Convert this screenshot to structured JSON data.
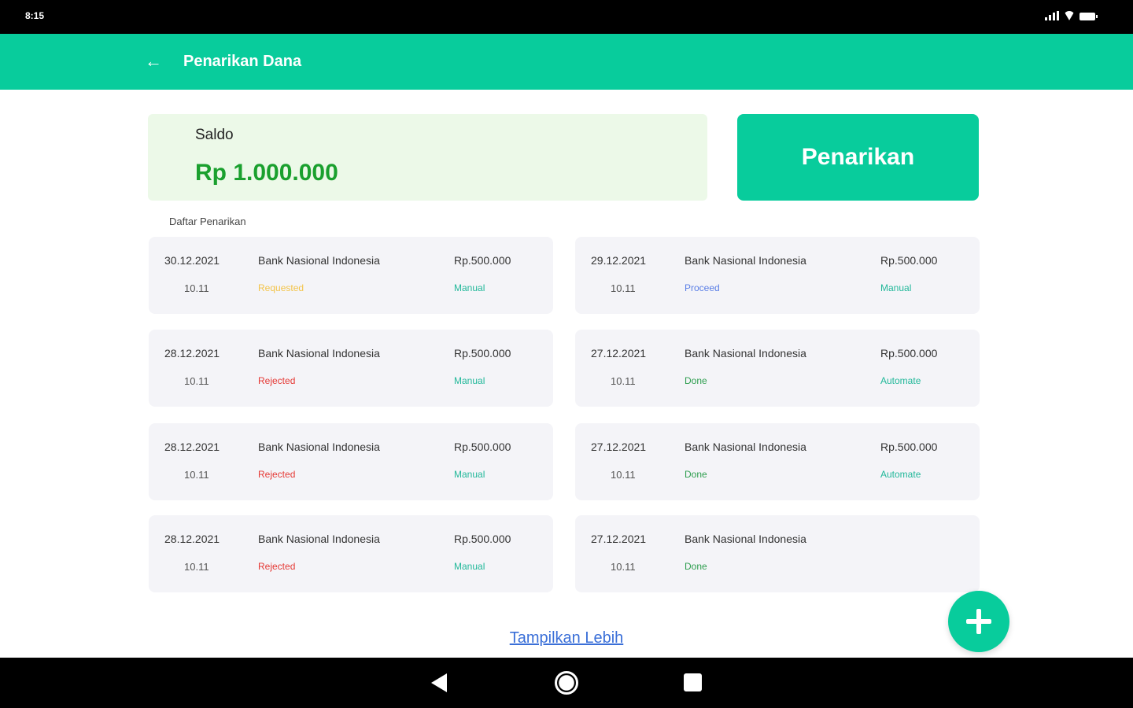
{
  "status_bar": {
    "time": "8:15"
  },
  "app_bar": {
    "back_icon": "←",
    "title": "Penarikan Dana"
  },
  "saldo": {
    "label": "Saldo",
    "value": "Rp 1.000.000"
  },
  "withdraw_button": {
    "label": "Penarikan"
  },
  "list_title": "Daftar Penarikan",
  "transactions": [
    {
      "date": "30.12.2021",
      "time": "10.11",
      "bank": "Bank Nasional Indonesia",
      "status": "Requested",
      "amount": "Rp.500.000",
      "type": "Manual"
    },
    {
      "date": "29.12.2021",
      "time": "10.11",
      "bank": "Bank Nasional Indonesia",
      "status": "Proceed",
      "amount": "Rp.500.000",
      "type": "Manual"
    },
    {
      "date": "28.12.2021",
      "time": "10.11",
      "bank": "Bank Nasional Indonesia",
      "status": "Rejected",
      "amount": "Rp.500.000",
      "type": "Manual"
    },
    {
      "date": "27.12.2021",
      "time": "10.11",
      "bank": "Bank Nasional Indonesia",
      "status": "Done",
      "amount": "Rp.500.000",
      "type": "Automate"
    },
    {
      "date": "28.12.2021",
      "time": "10.11",
      "bank": "Bank Nasional Indonesia",
      "status": "Rejected",
      "amount": "Rp.500.000",
      "type": "Manual"
    },
    {
      "date": "27.12.2021",
      "time": "10.11",
      "bank": "Bank Nasional Indonesia",
      "status": "Done",
      "amount": "Rp.500.000",
      "type": "Automate"
    },
    {
      "date": "28.12.2021",
      "time": "10.11",
      "bank": "Bank Nasional Indonesia",
      "status": "Rejected",
      "amount": "Rp.500.000",
      "type": "Manual"
    },
    {
      "date": "27.12.2021",
      "time": "10.11",
      "bank": "Bank Nasional Indonesia",
      "status": "Done",
      "amount": "",
      "type": ""
    }
  ],
  "show_more": "Tampilkan Lebih",
  "fab": {
    "icon": "plus-icon"
  },
  "colors": {
    "primary": "#08cc9c",
    "saldo_bg": "#ecf9e8",
    "saldo_text": "#1aa02e",
    "requested": "#f3c44a",
    "rejected": "#e53935",
    "proceed": "#5b7fe6",
    "done": "#2e9e4f"
  }
}
